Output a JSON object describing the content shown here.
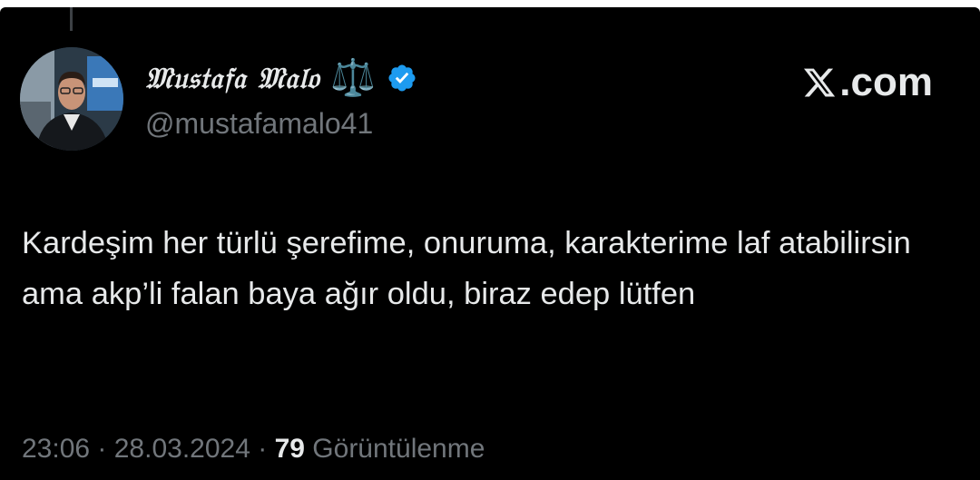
{
  "author": {
    "display_name": "𝔐𝔲𝔰𝔱𝔞𝔣𝔞 𝔐𝔞𝔩𝔬",
    "name_emoji": "⚖️",
    "handle": "@mustafamalo41",
    "verified": true
  },
  "source": {
    "logo_icon": "x-logo-icon",
    "suffix": ".com"
  },
  "tweet": {
    "text": "Kardeşim her türlü şerefime, onuruma, karakterime laf atabilirsin ama akp’li falan baya ağır oldu, biraz edep lütfen"
  },
  "meta": {
    "time": "23:06",
    "date": "28.03.2024",
    "separator": " · ",
    "views_count": "79",
    "views_label": "Görüntülenme"
  },
  "colors": {
    "background": "#000000",
    "text_primary": "#e7e9ea",
    "text_secondary": "#71767b",
    "verified_blue": "#1d9bf0"
  }
}
